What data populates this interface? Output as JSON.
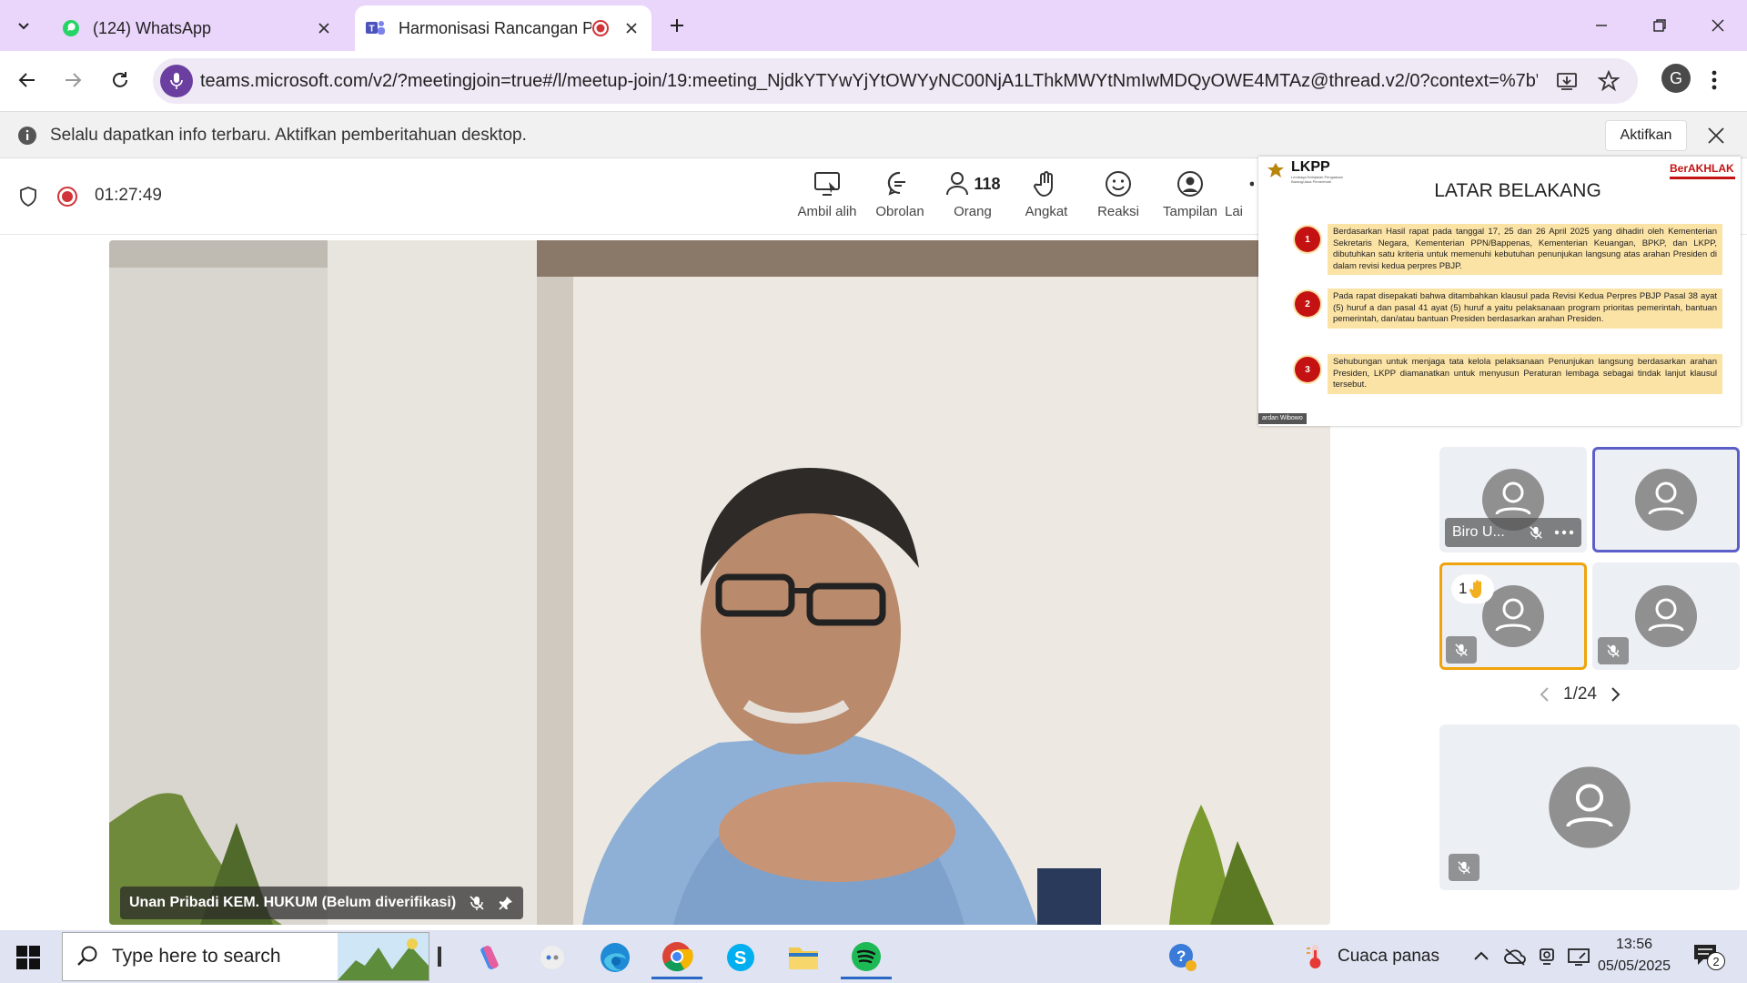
{
  "browser": {
    "tabs": [
      {
        "title": "(124) WhatsApp",
        "icon": "whatsapp-icon",
        "active": false
      },
      {
        "title": "Harmonisasi Rancangan Pe",
        "icon": "teams-icon",
        "active": true,
        "recording": true
      }
    ],
    "url": "teams.microsoft.com/v2/?meetingjoin=true#/l/meetup-join/19:meeting_NjdkYTYwYjYtOWYyNC00NjA1LThkMWYtNmIwMDQyOWE4MTAz@thread.v2/0?context=%7b\"T...",
    "profile_initial": "G"
  },
  "notification": {
    "message": "Selalu dapatkan info terbaru. Aktifkan pemberitahuan desktop.",
    "enable_label": "Aktifkan"
  },
  "meeting": {
    "timer": "01:27:49",
    "toolbar": [
      {
        "key": "takecontrol",
        "label": "Ambil alih",
        "icon": "take-control-icon"
      },
      {
        "key": "chat",
        "label": "Obrolan",
        "icon": "chat-icon"
      },
      {
        "key": "people",
        "label": "Orang",
        "icon": "people-icon",
        "count": "118"
      },
      {
        "key": "raise",
        "label": "Angkat",
        "icon": "raise-hand-icon"
      },
      {
        "key": "react",
        "label": "Reaksi",
        "icon": "reaction-icon"
      },
      {
        "key": "view",
        "label": "Tampilan",
        "icon": "view-icon"
      },
      {
        "key": "more",
        "label": "Lai",
        "icon": "more-icon"
      }
    ],
    "main_participant": "Unan Pribadi KEM. HUKUM (Belum diverifikasi)",
    "tiles": [
      {
        "name": "Biro U...",
        "muted": true
      },
      {
        "name": "",
        "muted": false,
        "speaking": true
      },
      {
        "name": "",
        "muted": true,
        "hand_raised": true,
        "hand_count": "1"
      },
      {
        "name": "",
        "muted": true
      }
    ],
    "pager": "1/24"
  },
  "slide": {
    "logo": "LKPP",
    "logo_sub": "Lembaga Kebijakan Pengadaan Barang/Jasa Pemerintah",
    "badge": "BerAKHLAK",
    "title": "LATAR BELAKANG",
    "items": [
      {
        "num": "1",
        "text": "Berdasarkan Hasil rapat pada tanggal 17, 25 dan 26 April 2025 yang dihadiri oleh Kementerian Sekretaris Negara, Kementerian PPN/Bappenas, Kementerian Keuangan, BPKP, dan LKPP, dibutuhkan satu kriteria untuk memenuhi kebutuhan penunjukan langsung atas arahan Presiden di dalam revisi kedua perpres PBJP."
      },
      {
        "num": "2",
        "text": "Pada rapat disepakati bahwa ditambahkan klausul pada Revisi Kedua Perpres PBJP Pasal 38 ayat (5) huruf a dan pasal 41 ayat (5) huruf a yaitu pelaksanaan program prioritas pemerintah, bantuan pemerintah, dan/atau bantuan Presiden berdasarkan arahan Presiden."
      },
      {
        "num": "3",
        "text": "Sehubungan untuk menjaga tata kelola pelaksanaan Penunjukan langsung berdasarkan arahan Presiden, LKPP diamanatkan untuk menyusun Peraturan lembaga sebagai tindak lanjut klausul tersebut."
      }
    ],
    "presenter": "ardan Wibowo"
  },
  "taskbar": {
    "search_placeholder": "Type here to search",
    "weather": "Cuaca panas",
    "time": "13:56",
    "date": "05/05/2025",
    "notification_count": "2"
  },
  "colors": {
    "tabstrip": "#ead5fb",
    "teams_accent": "#5b5fc7",
    "record": "#d13438",
    "speaking": "#f0a30a"
  }
}
